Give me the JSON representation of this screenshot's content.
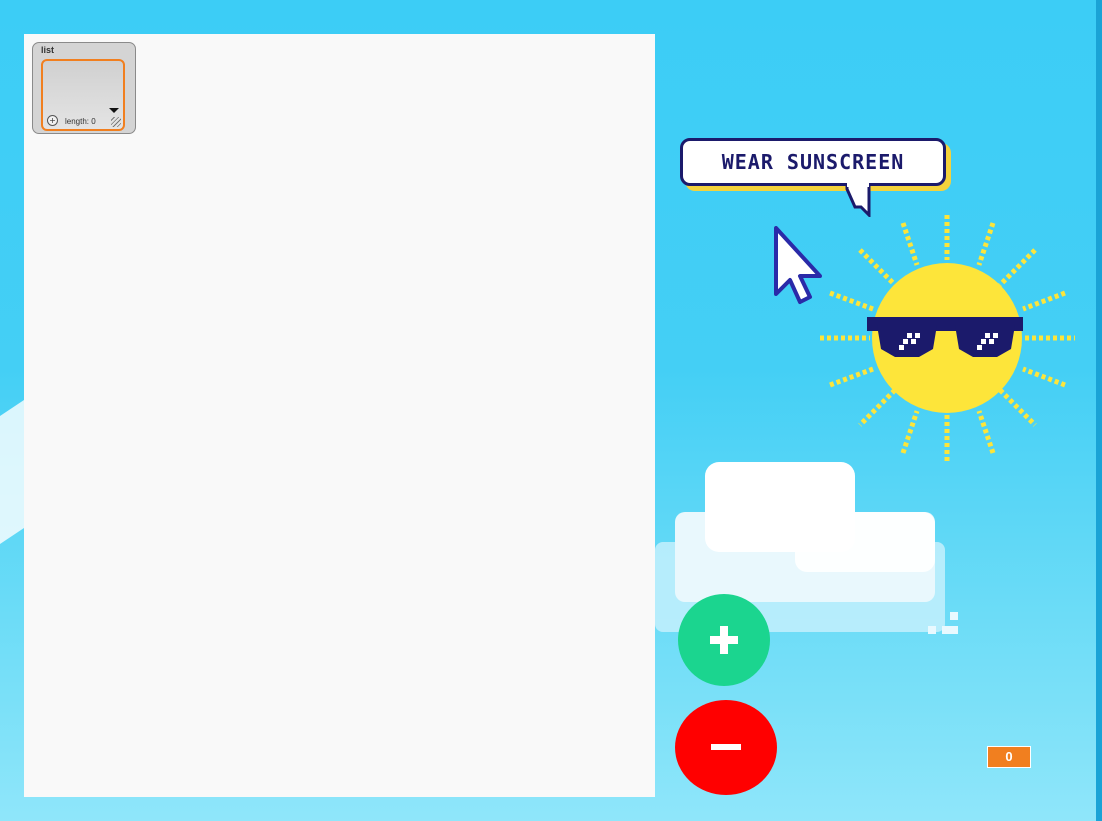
{
  "list_monitor": {
    "title": "list",
    "length_text": "length: 0",
    "add_icon": "plus-circle-icon",
    "dropdown_icon": "triangle-down-icon",
    "resize_icon": "resize-handle-icon"
  },
  "speech_bubble": {
    "text": "WEAR SUNSCREEN"
  },
  "buttons": {
    "add_icon": "plus-icon",
    "remove_icon": "minus-icon"
  },
  "score": {
    "value": "0"
  },
  "colors": {
    "sky": "#3ccdf6",
    "panel": "#f9f9f9",
    "add_button": "#1bd58f",
    "remove_button": "#ff0000",
    "accent_orange": "#f17f1f",
    "sun": "#fde53a",
    "sunglasses": "#1b1a6b"
  }
}
